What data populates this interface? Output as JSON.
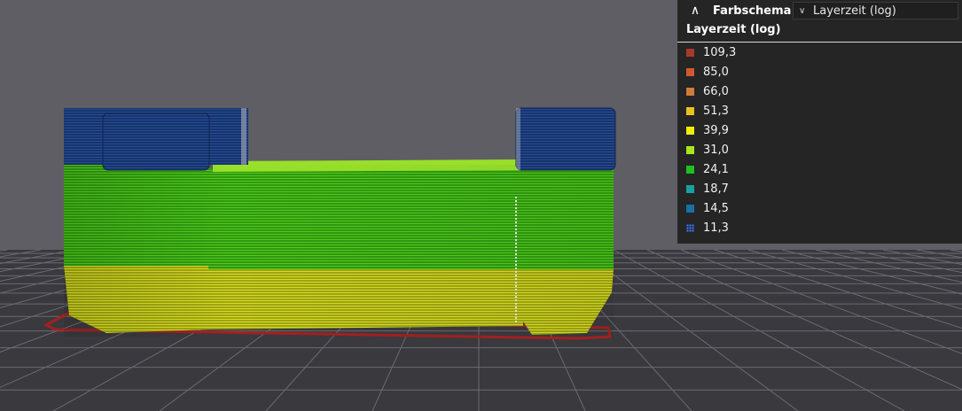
{
  "panel": {
    "header_label": "Farbschema",
    "select_value": "Layerzeit (log)",
    "legend_title": "Layerzeit (log)"
  },
  "legend": [
    {
      "value": "109,3",
      "color": "#a83a2a"
    },
    {
      "value": "85,0",
      "color": "#d0582e"
    },
    {
      "value": "66,0",
      "color": "#d07a3c"
    },
    {
      "value": "51,3",
      "color": "#e8c21a"
    },
    {
      "value": "39,9",
      "color": "#f0f000"
    },
    {
      "value": "31,0",
      "color": "#a8e81a"
    },
    {
      "value": "24,1",
      "color": "#20c020"
    },
    {
      "value": "18,7",
      "color": "#1aa0a0"
    },
    {
      "value": "14,5",
      "color": "#1a70a8"
    },
    {
      "value": "11,3",
      "color": "#2a4fa8",
      "pattern": "dotted"
    }
  ],
  "icons": {
    "collapse": "chevron-up-double-icon",
    "select": "chevron-down-icon"
  },
  "colors": {
    "background": "#5f5e64",
    "floor": "#3a393e",
    "grid_line": "#6b6a70",
    "skirt": "#a02020",
    "panel_bg": "#252526"
  }
}
